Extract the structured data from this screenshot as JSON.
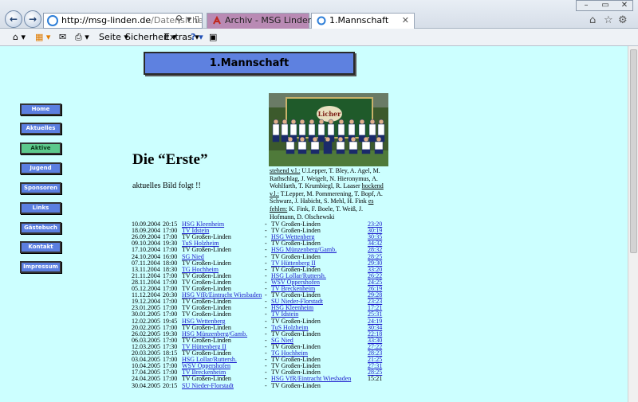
{
  "browser": {
    "address": {
      "host": "http://msg-linden.de",
      "path": "/Datensicherung-08"
    },
    "tabs": [
      {
        "label": "Archiv - MSG Linden"
      },
      {
        "label": "1.Mannschaft"
      }
    ],
    "commands": {
      "page": "Seite",
      "security": "Sicherheit",
      "extras": "Extras"
    }
  },
  "page": {
    "header": "1.Mannschaft",
    "menu": [
      "Home",
      "Aktuelles",
      "Aktive",
      "Jugend",
      "Sponsoren",
      "Links",
      "Gästebuch",
      "Kontakt",
      "Impressum"
    ],
    "heading": "Die “Erste”",
    "subheading": "aktuelles Bild folgt !!",
    "caption": {
      "stehend_label": "stehend v.l.:",
      "stehend": "U.Lepper, T. Bley, A. Agel, M. Rathschlag, J. Weigelt, N. Hieronymus, A. Wohlfarth, T. Krumbiegl, R. Laaser",
      "hockend_label": "hockend v.l.:",
      "hockend": "T.Lepper, M. Pommerening, T. Bopf, A. Schwarz, J. Habicht, S. Mehl, H. Fink",
      "fehlen_label": "es fehlen:",
      "fehlen": "K. Fink, F. Boele, T. Weiß, J. Hofmann, D. Olschewski"
    },
    "fixtures": [
      {
        "date": "10.09.2004",
        "time": "20:15",
        "home": "HSG Kleenheim",
        "away": "TV Großen-Linden",
        "score": "23:20"
      },
      {
        "date": "18.09.2004",
        "time": "17:00",
        "home": "TV Idstein",
        "away": "TV Großen-Linden",
        "score": "30:19"
      },
      {
        "date": "26.09.2004",
        "time": "17:00",
        "home": "TV Großen-Linden",
        "away": "HSG Wettenberg",
        "score": "30:35"
      },
      {
        "date": "09.10.2004",
        "time": "19:30",
        "home": "TuS Holzheim",
        "away": "TV Großen-Linden",
        "score": "34:32"
      },
      {
        "date": "17.10.2004",
        "time": "17:00",
        "home": "TV Großen-Linden",
        "away": "HSG Münzenberg/Gamb.",
        "score": "28:32"
      },
      {
        "date": "24.10.2004",
        "time": "16:00",
        "home": "SG Nied",
        "away": "TV Großen-Linden",
        "score": "28:25"
      },
      {
        "date": "07.11.2004",
        "time": "18:00",
        "home": "TV Großen-Linden",
        "away": "TV Hüttenberg II",
        "score": "29:30"
      },
      {
        "date": "13.11.2004",
        "time": "18:30",
        "home": "TG Hochheim",
        "away": "TV Großen-Linden",
        "score": "33:20"
      },
      {
        "date": "21.11.2004",
        "time": "17:00",
        "home": "TV Großen-Linden",
        "away": "HSG Lollar/Ruttersh.",
        "score": "26:22"
      },
      {
        "date": "28.11.2004",
        "time": "17:00",
        "home": "TV Großen-Linden",
        "away": "WSV Oppershofen",
        "score": "24:25"
      },
      {
        "date": "05.12.2004",
        "time": "17:00",
        "home": "TV Großen-Linden",
        "away": "TV Breckenheim",
        "score": "26:19"
      },
      {
        "date": "11.12.2004",
        "time": "20:30",
        "home": "HSG VfR/Eintracht Wiesbaden",
        "away": "TV Großen-Linden",
        "score": "29:28"
      },
      {
        "date": "19.12.2004",
        "time": "17:00",
        "home": "TV Großen-Linden",
        "away": "SU Nieder-Florstadt",
        "score": "23:23"
      },
      {
        "date": "23.01.2005",
        "time": "17:00",
        "home": "TV Großen-Linden",
        "away": "HSG Kleenheim",
        "score": "17:21"
      },
      {
        "date": "30.01.2005",
        "time": "17:00",
        "home": "TV Großen-Linden",
        "away": "TV Idstein",
        "score": "25:31"
      },
      {
        "date": "12.02.2005",
        "time": "19:45",
        "home": "HSG Wettenberg",
        "away": "TV Großen-Linden",
        "score": "24:19"
      },
      {
        "date": "20.02.2005",
        "time": "17:00",
        "home": "TV Großen-Linden",
        "away": "TuS Holzheim",
        "score": "30:34"
      },
      {
        "date": "26.02.2005",
        "time": "19:30",
        "home": "HSG Münzenberg/Gamb.",
        "away": "TV Großen-Linden",
        "score": "22:18"
      },
      {
        "date": "06.03.2005",
        "time": "17:00",
        "home": "TV Großen-Linden",
        "away": "SG Nied",
        "score": "33:30"
      },
      {
        "date": "12.03.2005",
        "time": "17:30",
        "home": "TV Hüttenberg II",
        "away": "TV Großen-Linden",
        "score": "27:22"
      },
      {
        "date": "20.03.2005",
        "time": "18:15",
        "home": "TV Großen-Linden",
        "away": "TG Hochheim",
        "score": "28:23"
      },
      {
        "date": "03.04.2005",
        "time": "17:00",
        "home": "HSG Lollar/Ruttersh.",
        "away": "TV Großen-Linden",
        "score": "21:25"
      },
      {
        "date": "10.04.2005",
        "time": "17:00",
        "home": "WSV Oppershofen",
        "away": "TV Großen-Linden",
        "score": "27:31"
      },
      {
        "date": "17.04.2005",
        "time": "17:00",
        "home": "TV Breckenheim",
        "away": "TV Großen-Linden",
        "score": "28:25"
      },
      {
        "date": "24.04.2005",
        "time": "17:00",
        "home": "TV Großen-Linden",
        "away": "HSG VfR/Eintracht Wiesbaden",
        "score": "15:21"
      },
      {
        "date": "30.04.2005",
        "time": "20:15",
        "home": "SU Nieder-Florstadt",
        "away": "TV Großen-Linden",
        "score": ""
      }
    ],
    "dash": "-",
    "score_link_rows": 24
  }
}
